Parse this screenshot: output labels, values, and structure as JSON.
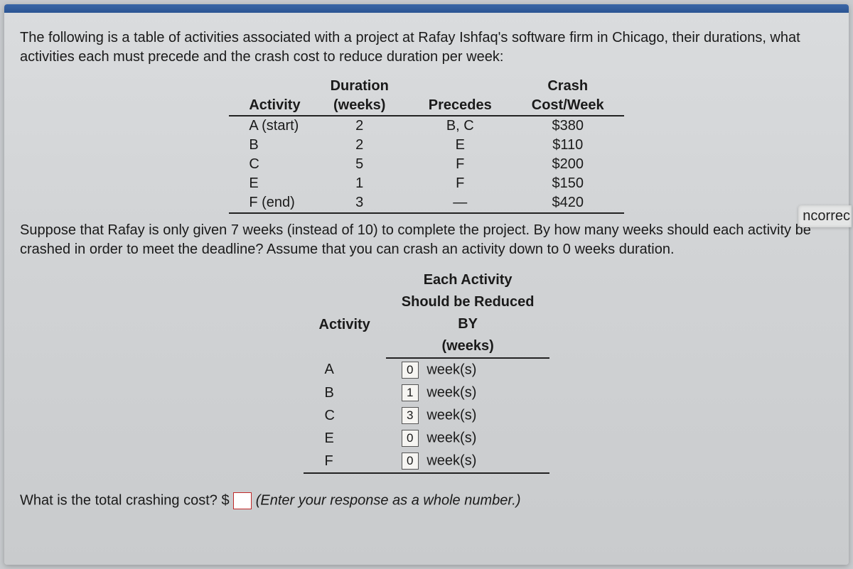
{
  "intro": "The following is a table of activities associated with a project at Rafay Ishfaq's software firm in Chicago, their durations, what activities each must precede and the crash cost to reduce duration per week:",
  "table1": {
    "headers": {
      "activity": "Activity",
      "duration_top": "Duration",
      "duration_bottom": "(weeks)",
      "precedes": "Precedes",
      "crash_top": "Crash",
      "crash_bottom": "Cost/Week"
    },
    "rows": [
      {
        "activity": "A (start)",
        "duration": "2",
        "precedes": "B, C",
        "cost": "$380"
      },
      {
        "activity": "B",
        "duration": "2",
        "precedes": "E",
        "cost": "$110"
      },
      {
        "activity": "C",
        "duration": "5",
        "precedes": "F",
        "cost": "$200"
      },
      {
        "activity": "E",
        "duration": "1",
        "precedes": "F",
        "cost": "$150"
      },
      {
        "activity": "F (end)",
        "duration": "3",
        "precedes": "—",
        "cost": "$420"
      }
    ]
  },
  "mid_para": "Suppose that Rafay is only given 7 weeks (instead of 10) to complete the project. By how many weeks should each activity be crashed in order to meet the deadline? Assume that you can crash an activity down to 0 weeks duration.",
  "table2": {
    "headers": {
      "activity": "Activity",
      "reduced_l1": "Each Activity",
      "reduced_l2": "Should be Reduced",
      "reduced_l3": "BY",
      "reduced_l4": "(weeks)"
    },
    "rows": [
      {
        "activity": "A",
        "value": "0",
        "unit": "week(s)"
      },
      {
        "activity": "B",
        "value": "1",
        "unit": "week(s)"
      },
      {
        "activity": "C",
        "value": "3",
        "unit": "week(s)"
      },
      {
        "activity": "E",
        "value": "0",
        "unit": "week(s)"
      },
      {
        "activity": "F",
        "value": "0",
        "unit": "week(s)"
      }
    ]
  },
  "question": {
    "prefix": "What is the total crashing cost? $",
    "hint": "(Enter your response as a whole number.)"
  },
  "side_tag": "ncorrec"
}
